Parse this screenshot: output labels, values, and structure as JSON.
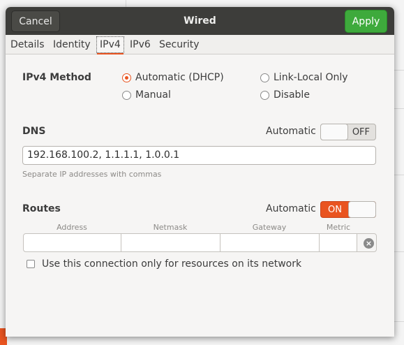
{
  "header": {
    "cancel_label": "Cancel",
    "title": "Wired",
    "apply_label": "Apply"
  },
  "tabs": [
    {
      "label": "Details"
    },
    {
      "label": "Identity"
    },
    {
      "label": "IPv4",
      "active": true
    },
    {
      "label": "IPv6"
    },
    {
      "label": "Security"
    }
  ],
  "ipv4_method": {
    "label": "IPv4 Method",
    "options": [
      {
        "label": "Automatic (DHCP)",
        "selected": true
      },
      {
        "label": "Link-Local Only",
        "selected": false
      },
      {
        "label": "Manual",
        "selected": false
      },
      {
        "label": "Disable",
        "selected": false
      }
    ]
  },
  "dns": {
    "label": "DNS",
    "automatic_label": "Automatic",
    "switch_text": "OFF",
    "switch_on": false,
    "value": "192.168.100.2, 1.1.1.1, 1.0.0.1",
    "hint": "Separate IP addresses with commas"
  },
  "routes": {
    "label": "Routes",
    "automatic_label": "Automatic",
    "switch_text": "ON",
    "switch_on": true,
    "columns": [
      "Address",
      "Netmask",
      "Gateway",
      "Metric"
    ],
    "values": [
      "",
      "",
      "",
      ""
    ]
  },
  "resource_only": {
    "label": "Use this connection only for resources on its network",
    "checked": false
  },
  "colors": {
    "accent": "#e95420",
    "apply_green": "#3eaa3c",
    "header_bg": "#3d3d3a"
  }
}
